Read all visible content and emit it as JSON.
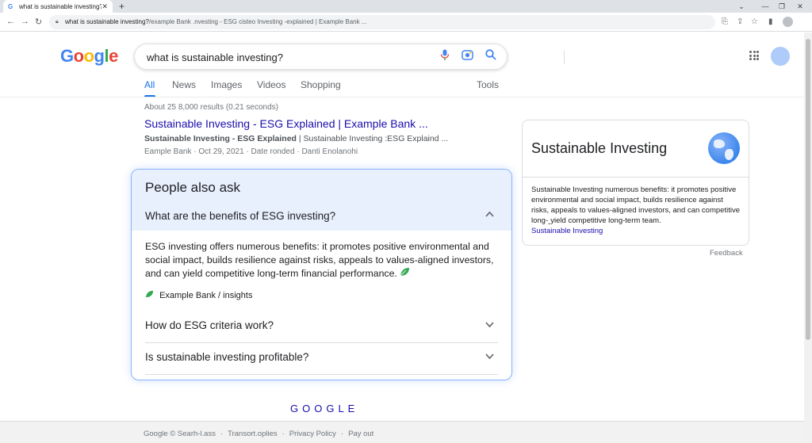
{
  "browser": {
    "tab_title": "what is sustainable investing?",
    "tab_close": "✕",
    "new_tab": "+",
    "url_host": "what is sustainable investing?",
    "url_path": "/example Bank .nvesting - ESG cisteo Investing -explained | Example Bank ..."
  },
  "search": {
    "logo": [
      "G",
      "o",
      "o",
      "g",
      "l",
      "e"
    ],
    "logo_colors": [
      "#4285f4",
      "#ea4335",
      "#fbbc05",
      "#4285f4",
      "#34a853",
      "#ea4335"
    ],
    "query": "what is sustainable investing?"
  },
  "tabs": {
    "items": [
      "All",
      "News",
      "Images",
      "Videos",
      "Shopping"
    ],
    "tools": "Tools"
  },
  "results": {
    "stats": "About 25 8,000 results (0.21 seconds)",
    "title": "Sustainable Investing - ESG Explained | Example Bank ...",
    "snippet_bold": "Sustainable  Investing - ESG Explained",
    "snippet_rest": " | Sustainable Investing :ESG Explaind ...",
    "meta": "Eample Bank · Oct 29, 2021 · Date ronded · Danti Enolanohi"
  },
  "paa": {
    "title": "People also ask",
    "q1": "What are the benefits of ESG investing?",
    "answer": "ESG investing offers numerous benefits: it promotes positive environmental and social impact, builds resilience against risks, appeals to values-aligned investors, and can yield competitive long-term financial performance.",
    "source": "Example Bank / insights",
    "q2": "How do ESG criteria work?",
    "q3": "Is sustainable investing profitable?"
  },
  "knowledge_panel": {
    "title": "Sustainable Investing",
    "description": "Sustainable Investing numerous benefits: it promotes positive environmental and social impact, builds resilience against risks, appeals to values-aligned investors, and can competitive long-ˬyield competitive long-term team.",
    "link": "Sustainable Investing",
    "feedback": "Feedback"
  },
  "footer": {
    "logo": "GOOGLE",
    "links": [
      "Google © Searh-l.ass",
      "Transort.oplies",
      "Privacy Policy",
      "Pay out"
    ]
  },
  "colors": {
    "link": "#1a0dab",
    "accent": "#1a73e8",
    "paa_header": "#e8f0fe"
  }
}
